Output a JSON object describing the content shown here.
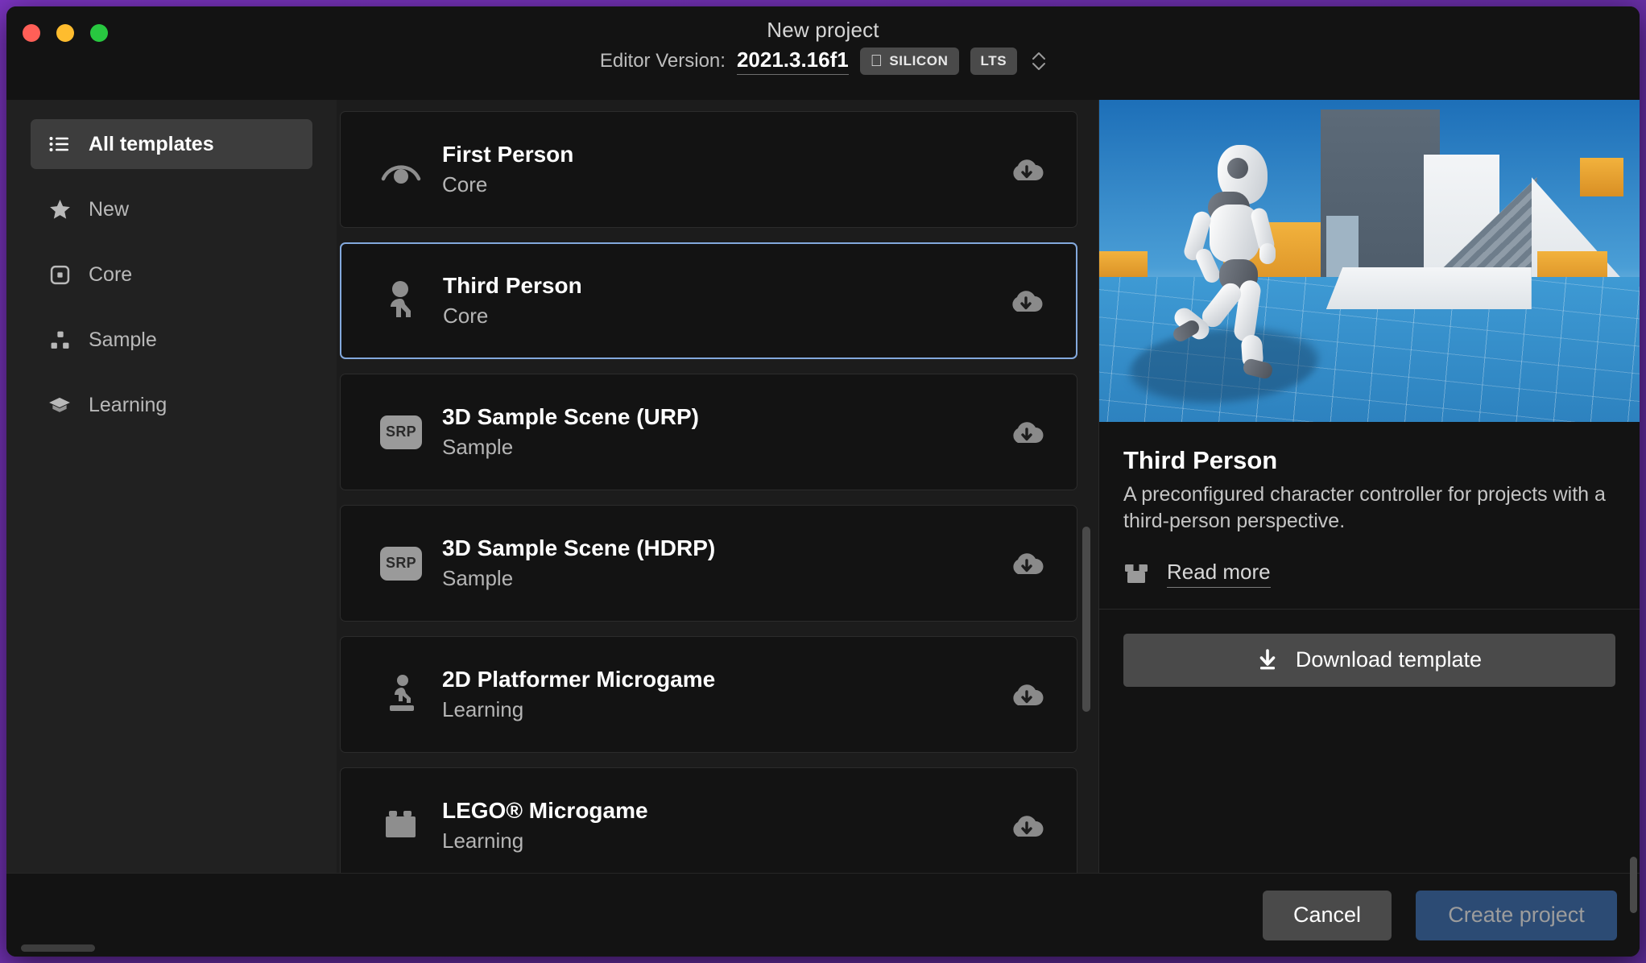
{
  "window": {
    "title": "New project",
    "traffic_lights": [
      "close",
      "minimize",
      "zoom"
    ]
  },
  "editor_version": {
    "label": "Editor Version:",
    "value": "2021.3.16f1",
    "badges": [
      {
        "icon": "apple-icon",
        "text": "SILICON"
      },
      {
        "icon": "",
        "text": "LTS"
      }
    ],
    "stepper_icon": "up-down-chevron-icon"
  },
  "sidebar": {
    "items": [
      {
        "label": "All templates",
        "icon": "list-icon",
        "active": true
      },
      {
        "label": "New",
        "icon": "star-icon",
        "active": false
      },
      {
        "label": "Core",
        "icon": "square-dot-icon",
        "active": false
      },
      {
        "label": "Sample",
        "icon": "hierarchy-icon",
        "active": false
      },
      {
        "label": "Learning",
        "icon": "graduation-cap-icon",
        "active": false
      }
    ]
  },
  "templates": [
    {
      "name": "First Person",
      "category": "Core",
      "icon": "eye-icon",
      "selected": false,
      "download_icon": "cloud-download-icon"
    },
    {
      "name": "Third Person",
      "category": "Core",
      "icon": "person-icon",
      "selected": true,
      "download_icon": "cloud-download-icon"
    },
    {
      "name": "3D Sample Scene (URP)",
      "category": "Sample",
      "icon": "srp-chip",
      "selected": false,
      "download_icon": "cloud-download-icon",
      "chip_text": "SRP"
    },
    {
      "name": "3D Sample Scene (HDRP)",
      "category": "Sample",
      "icon": "srp-chip",
      "selected": false,
      "download_icon": "cloud-download-icon",
      "chip_text": "SRP"
    },
    {
      "name": "2D Platformer Microgame",
      "category": "Learning",
      "icon": "runner-icon",
      "selected": false,
      "download_icon": "cloud-download-icon"
    },
    {
      "name": "LEGO® Microgame",
      "category": "Learning",
      "icon": "lego-brick-icon",
      "selected": false,
      "download_icon": "cloud-download-icon"
    }
  ],
  "detail": {
    "preview_alt": "Third Person template preview: white robot running in a blue grid scene with grey and white blocks",
    "title": "Third Person",
    "description": "A preconfigured character controller for projects with a third-person perspective.",
    "read_more": "Read more",
    "read_more_icon": "package-icon",
    "download_button": "Download template",
    "download_button_icon": "download-arrow-icon"
  },
  "footer": {
    "cancel": "Cancel",
    "create": "Create project"
  },
  "colors": {
    "selection_border": "#83a9dd",
    "primary_button": "#2c4b74",
    "secondary_button": "#4a4a4a",
    "window_background": "#131313",
    "sidebar_background": "#212121"
  }
}
